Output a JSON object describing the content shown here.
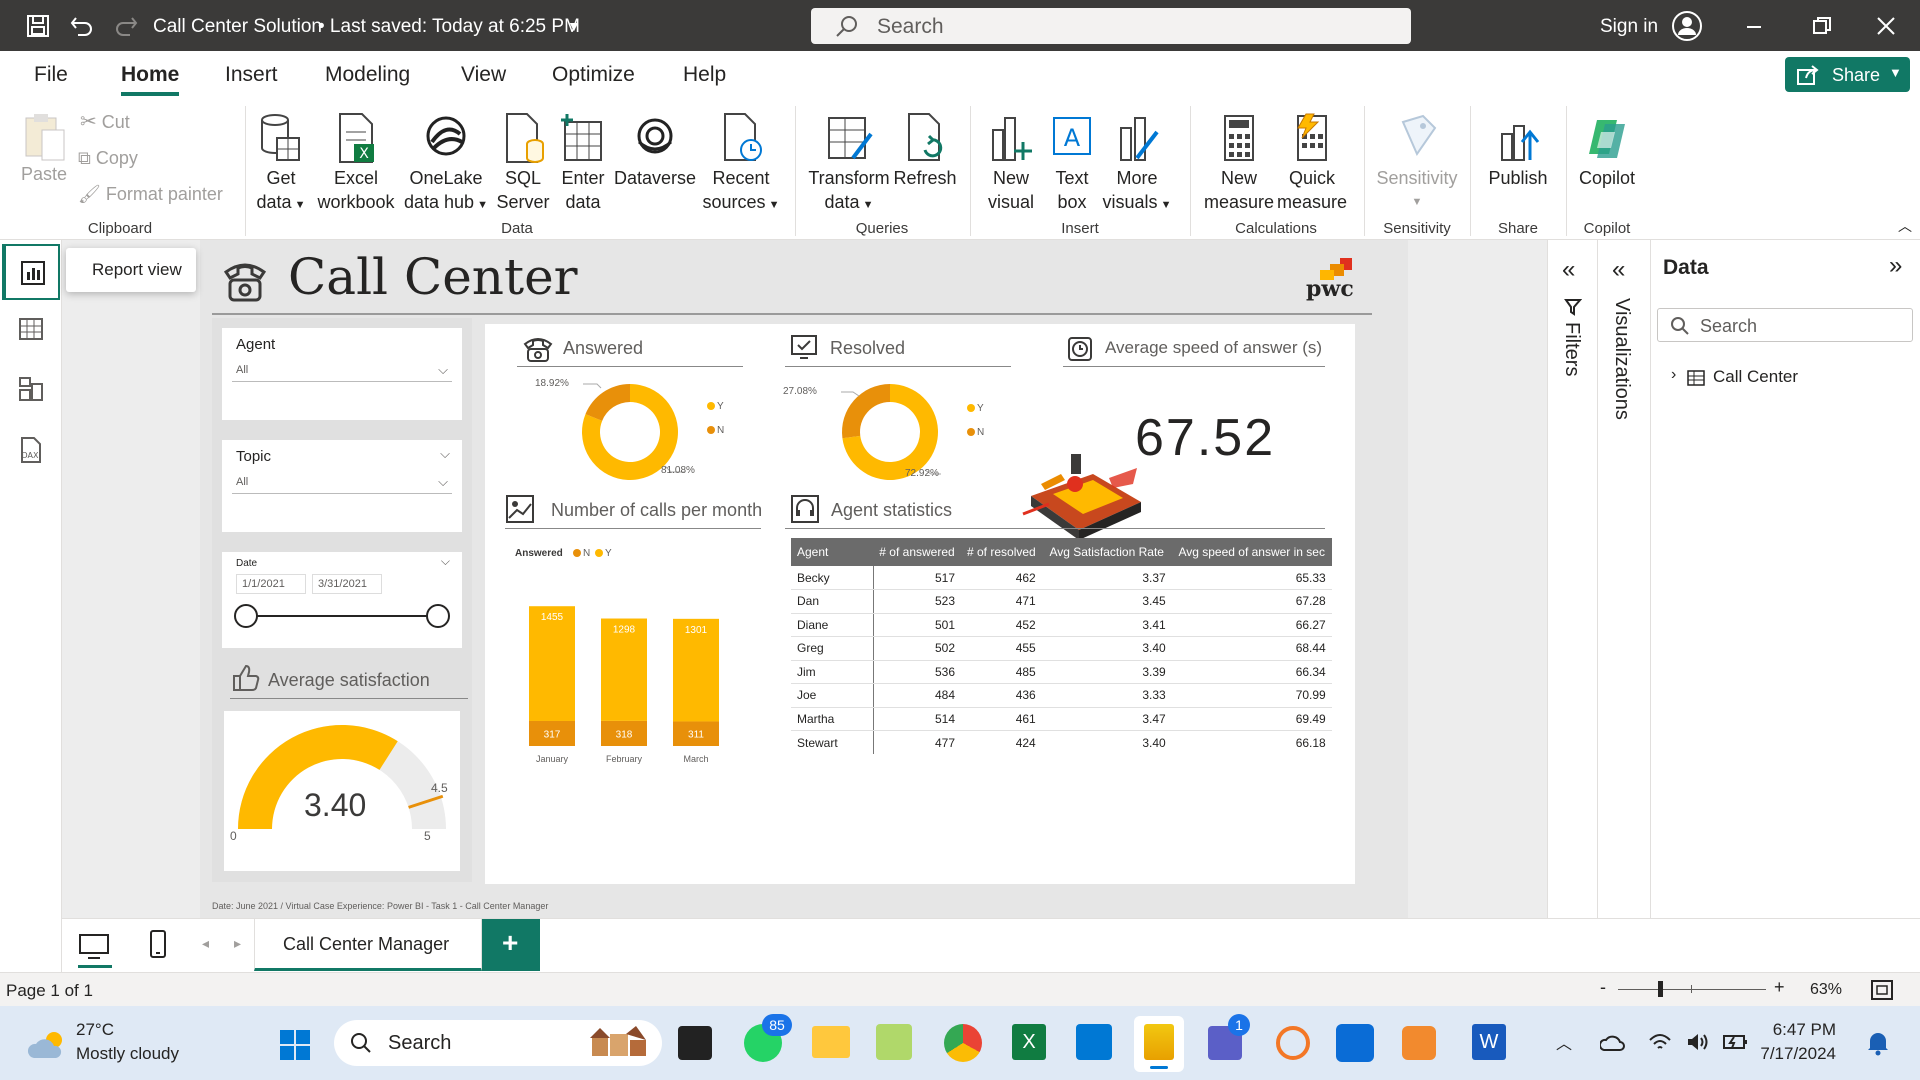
{
  "titlebar": {
    "title": "Call Center Solution",
    "saved": "• Last saved: Today at 6:25 PM",
    "search_placeholder": "Search",
    "sign_in": "Sign in"
  },
  "menu": {
    "items": [
      "File",
      "Home",
      "Insert",
      "Modeling",
      "View",
      "Optimize",
      "Help"
    ],
    "share": "Share"
  },
  "ribbon": {
    "clipboard": {
      "paste": "Paste",
      "cut": "Cut",
      "copy": "Copy",
      "format_painter": "Format painter",
      "group": "Clipboard"
    },
    "data": {
      "get_data_1": "Get",
      "get_data_2": "data",
      "excel_1": "Excel",
      "excel_2": "workbook",
      "onelake_1": "OneLake",
      "onelake_2": "data hub",
      "sql_1": "SQL",
      "sql_2": "Server",
      "enter_1": "Enter",
      "enter_2": "data",
      "dataverse": "Dataverse",
      "recent_1": "Recent",
      "recent_2": "sources",
      "group": "Data"
    },
    "queries": {
      "transform_1": "Transform",
      "transform_2": "data",
      "refresh": "Refresh",
      "group": "Queries"
    },
    "insert": {
      "newvis_1": "New",
      "newvis_2": "visual",
      "textbox_1": "Text",
      "textbox_2": "box",
      "more_1": "More",
      "more_2": "visuals",
      "group": "Insert"
    },
    "calc": {
      "newm_1": "New",
      "newm_2": "measure",
      "quick_1": "Quick",
      "quick_2": "measure",
      "group": "Calculations"
    },
    "sens": {
      "label": "Sensitivity",
      "group": "Sensitivity"
    },
    "share": {
      "publish": "Publish",
      "group": "Share"
    },
    "copilot": {
      "label": "Copilot",
      "group": "Copilot"
    }
  },
  "leftrail": {
    "tooltip": "Report view"
  },
  "report": {
    "title": "Call Center",
    "logo": "pwc",
    "slicers": {
      "agent_label": "Agent",
      "agent_value": "All",
      "topic_label": "Topic",
      "topic_value": "All",
      "date_label": "Date",
      "date_start": "1/1/2021",
      "date_end": "3/31/2021"
    },
    "avg_sat": {
      "title": "Average satisfaction",
      "value": "3.40",
      "min": "0",
      "max": "5",
      "target": "4.5",
      "value_num": 3.4,
      "min_num": 0,
      "max_num": 5,
      "target_num": 4.5
    },
    "answered": {
      "title": "Answered",
      "legend_y": "Y",
      "legend_n": "N",
      "pct_small": "18.92%",
      "pct_large": "81.08%"
    },
    "resolved": {
      "title": "Resolved",
      "legend_y": "Y",
      "legend_n": "N",
      "pct_small": "27.08%",
      "pct_large": "72.92%"
    },
    "speed": {
      "title": "Average speed of answer (s)",
      "value": "67.52"
    },
    "calls": {
      "title": "Number of calls per month",
      "legend_title": "Answered",
      "legend_n": "N",
      "legend_y": "Y"
    },
    "agents": {
      "title": "Agent statistics",
      "columns": [
        "Agent",
        "# of answered",
        "# of resolved",
        "Avg Satisfaction Rate",
        "Avg speed of answer in sec"
      ],
      "rows": [
        [
          "Becky",
          "517",
          "462",
          "3.37",
          "65.33"
        ],
        [
          "Dan",
          "523",
          "471",
          "3.45",
          "67.28"
        ],
        [
          "Diane",
          "501",
          "452",
          "3.41",
          "66.27"
        ],
        [
          "Greg",
          "502",
          "455",
          "3.40",
          "68.44"
        ],
        [
          "Jim",
          "536",
          "485",
          "3.39",
          "66.34"
        ],
        [
          "Joe",
          "484",
          "436",
          "3.33",
          "70.99"
        ],
        [
          "Martha",
          "514",
          "461",
          "3.47",
          "69.49"
        ],
        [
          "Stewart",
          "477",
          "424",
          "3.40",
          "66.18"
        ]
      ]
    },
    "footnote": "Date: June 2021 / Virtual Case Experience: Power BI - Task 1 - Call Center Manager"
  },
  "chart_data": [
    {
      "type": "bar",
      "title": "Number of calls per month",
      "categories": [
        "January",
        "February",
        "March"
      ],
      "series": [
        {
          "name": "N",
          "values": [
            317,
            318,
            311
          ]
        },
        {
          "name": "Y",
          "values": [
            1455,
            1298,
            1301
          ]
        }
      ],
      "stacked": true
    },
    {
      "type": "pie",
      "title": "Answered",
      "labels": [
        "Y",
        "N"
      ],
      "values": [
        81.08,
        18.92
      ]
    },
    {
      "type": "pie",
      "title": "Resolved",
      "labels": [
        "Y",
        "N"
      ],
      "values": [
        72.92,
        27.08
      ]
    }
  ],
  "panes": {
    "filters": "Filters",
    "visualizations": "Visualizations",
    "data_title": "Data",
    "data_search": "Search",
    "table": "Call Center"
  },
  "tabs": {
    "page": "Call Center Manager",
    "add": "+"
  },
  "status": {
    "page": "Page 1 of 1",
    "zoom": "63%",
    "minus": "-",
    "plus": "+"
  },
  "taskbar": {
    "temp": "27°C",
    "weather": "Mostly cloudy",
    "search": "Search",
    "badge_whatsapp": "85",
    "badge_teams": "1",
    "time": "6:47 PM",
    "date": "7/17/2024"
  },
  "colors": {
    "yellow": "#FFB900",
    "orange": "#E8900A",
    "accent": "#117865",
    "titlebar": "#3b3a39"
  }
}
